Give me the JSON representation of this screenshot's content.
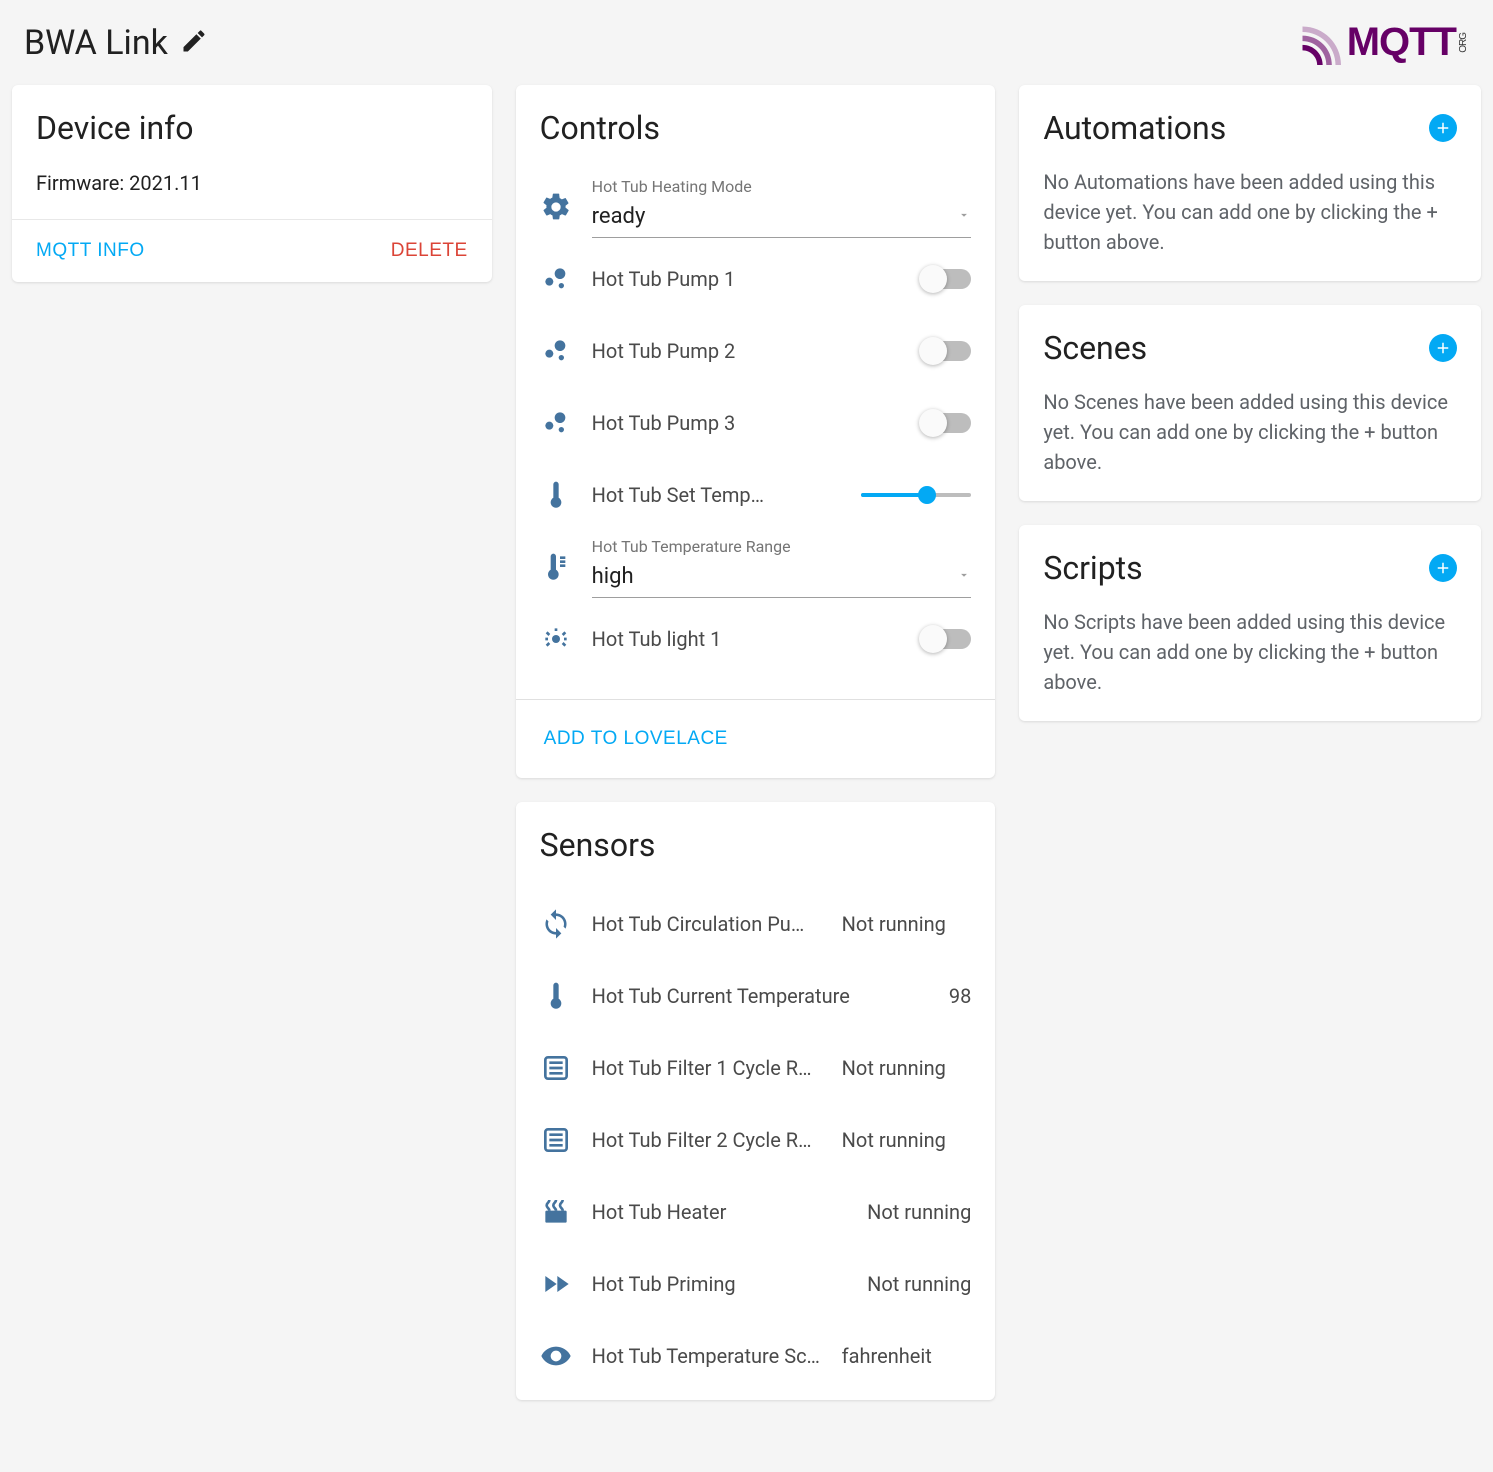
{
  "header": {
    "title": "BWA Link",
    "logo_text": "MQTT",
    "logo_suffix": "ORG"
  },
  "device_info": {
    "title": "Device info",
    "firmware_label": "Firmware:",
    "firmware_value": "2021.11",
    "mqtt_info_btn": "MQTT INFO",
    "delete_btn": "DELETE"
  },
  "controls": {
    "title": "Controls",
    "heating_mode_label": "Hot Tub Heating Mode",
    "heating_mode_value": "ready",
    "pump1_label": "Hot Tub Pump 1",
    "pump2_label": "Hot Tub Pump 2",
    "pump3_label": "Hot Tub Pump 3",
    "set_temp_label": "Hot Tub Set Temp…",
    "temp_range_label": "Hot Tub Temperature Range",
    "temp_range_value": "high",
    "light1_label": "Hot Tub light 1",
    "add_lovelace": "ADD TO LOVELACE"
  },
  "sensors": {
    "title": "Sensors",
    "items": [
      {
        "label": "Hot Tub Circulation Pu…",
        "value": "Not running"
      },
      {
        "label": "Hot Tub Current Temperature",
        "value": "98"
      },
      {
        "label": "Hot Tub Filter 1 Cycle R…",
        "value": "Not running"
      },
      {
        "label": "Hot Tub Filter 2 Cycle R…",
        "value": "Not running"
      },
      {
        "label": "Hot Tub Heater",
        "value": "Not running"
      },
      {
        "label": "Hot Tub Priming",
        "value": "Not running"
      },
      {
        "label": "Hot Tub Temperature Sc…",
        "value": "fahrenheit"
      }
    ]
  },
  "automations": {
    "title": "Automations",
    "text": "No Automations have been added using this device yet. You can add one by clicking the + button above."
  },
  "scenes": {
    "title": "Scenes",
    "text": "No Scenes have been added using this device yet. You can add one by clicking the + button above."
  },
  "scripts": {
    "title": "Scripts",
    "text": "No Scripts have been added using this device yet. You can add one by clicking the + button above."
  }
}
